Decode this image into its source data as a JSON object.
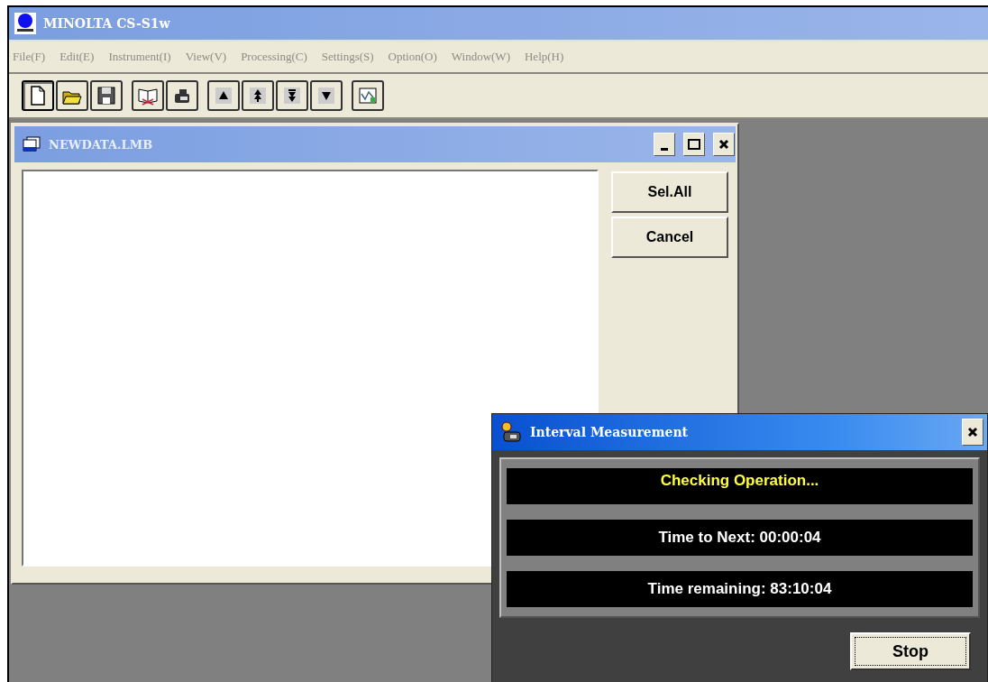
{
  "window": {
    "title": "MINOLTA CS-S1w"
  },
  "menu": [
    {
      "label": "File(F)",
      "disabled": true
    },
    {
      "label": "Edit(E)",
      "disabled": true
    },
    {
      "label": "Instrument(I)",
      "disabled": true
    },
    {
      "label": "View(V)",
      "disabled": true
    },
    {
      "label": "Processing(C)",
      "disabled": true
    },
    {
      "label": "Settings(S)",
      "disabled": true
    },
    {
      "label": "Option(O)",
      "disabled": true
    },
    {
      "label": "Window(W)",
      "disabled": true
    },
    {
      "label": "Help(H)",
      "disabled": true
    }
  ],
  "toolbar": [
    [
      {
        "kind": "new",
        "pressed": true
      },
      {
        "kind": "open",
        "pressed": false
      },
      {
        "kind": "save",
        "pressed": false
      }
    ],
    [
      {
        "kind": "book",
        "pressed": false
      },
      {
        "kind": "instrument",
        "pressed": false
      }
    ],
    [
      {
        "kind": "first",
        "pressed": false
      },
      {
        "kind": "prev",
        "pressed": false
      },
      {
        "kind": "next",
        "pressed": false
      },
      {
        "kind": "last",
        "pressed": false
      }
    ],
    [
      {
        "kind": "graph",
        "pressed": false
      }
    ]
  ],
  "data_window": {
    "title": "NEWDATA.LMB",
    "buttons": [
      "Sel.All",
      "Cancel"
    ]
  },
  "dialog": {
    "title": "Interval Measurement",
    "lines": [
      {
        "text": "Checking Operation...",
        "kind": "status"
      },
      {
        "text": "Time to Next: 00:00:04",
        "kind": "info"
      },
      {
        "text": "Time remaining: 83:10:04",
        "kind": "info"
      }
    ],
    "button": {
      "label": "Stop",
      "focused": true
    }
  }
}
